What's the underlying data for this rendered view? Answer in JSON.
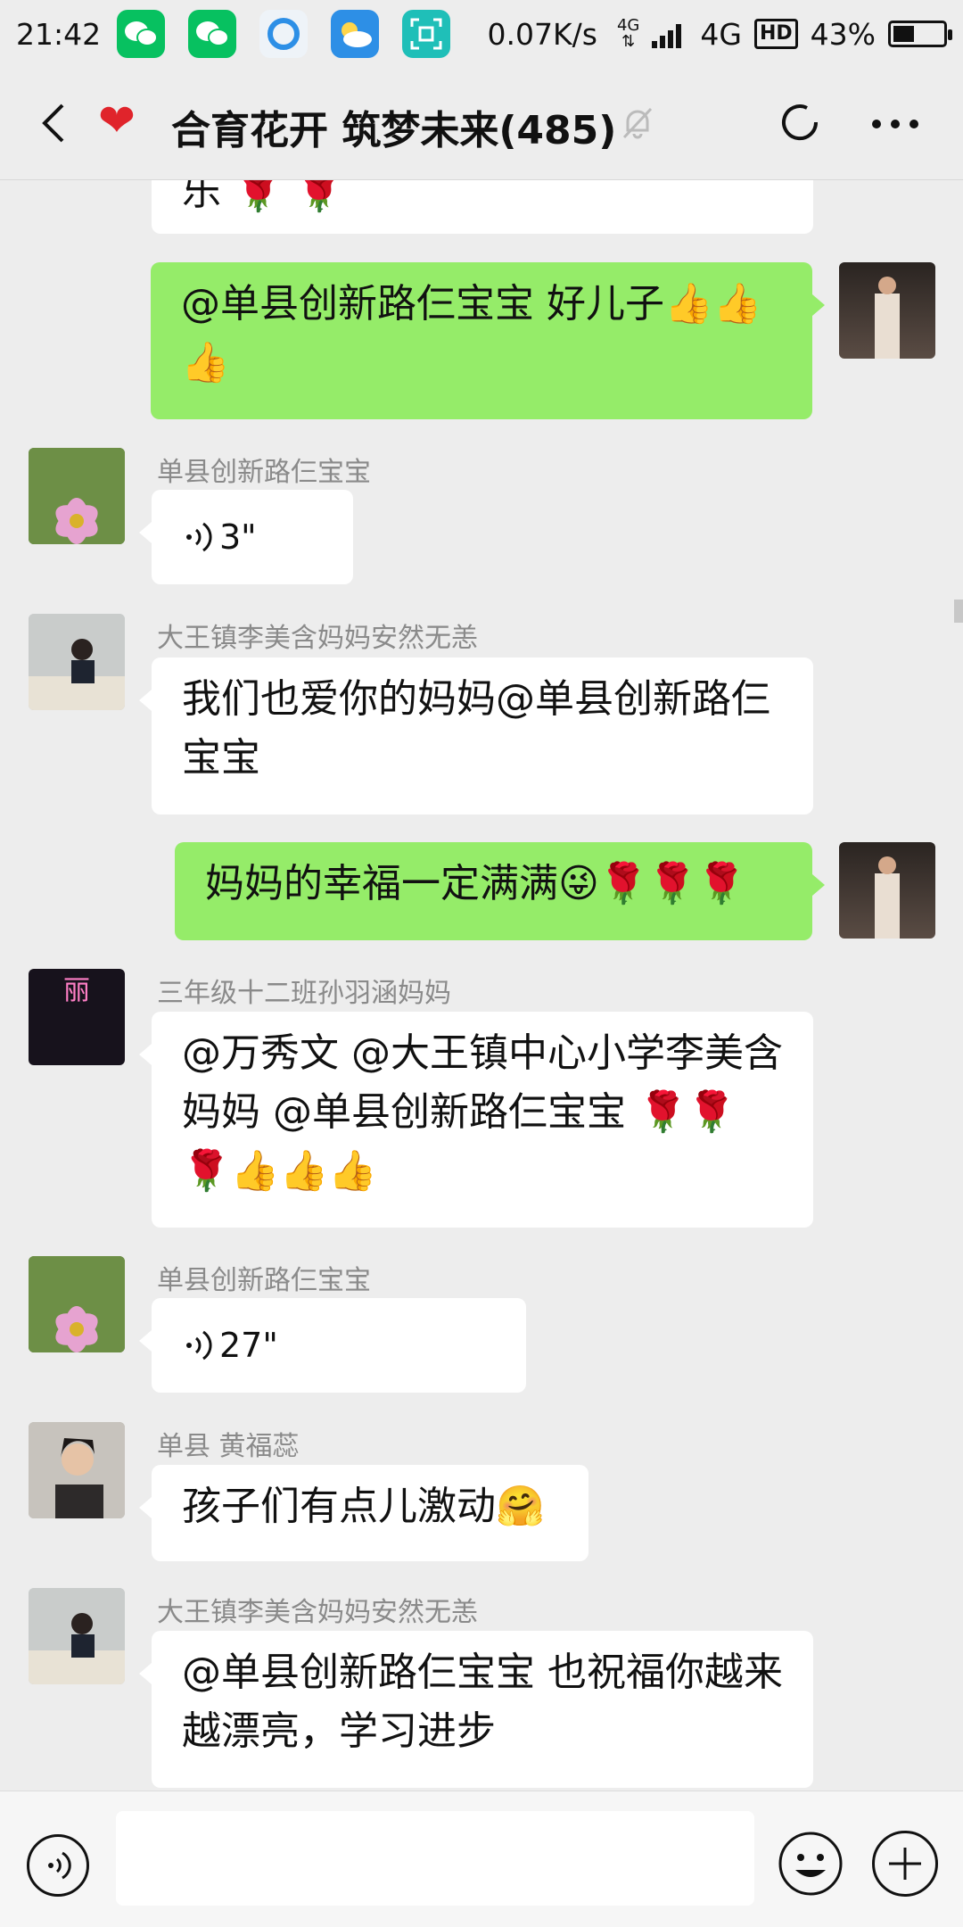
{
  "status_bar": {
    "time": "21:42",
    "net_speed": "0.07K/s",
    "net_type_small": "4G",
    "net_type": "4G",
    "hd": "HD",
    "battery": "43%",
    "battery_level": 0.43,
    "apps": [
      {
        "icon": "wechat-icon",
        "color": "#07c160"
      },
      {
        "icon": "wechat-icon",
        "color": "#07c160"
      },
      {
        "icon": "browser-icon",
        "color": "#eef3f8"
      },
      {
        "icon": "weather-icon",
        "color": "#2d8fe6"
      },
      {
        "icon": "scanner-icon",
        "color": "#1fbfb8"
      }
    ]
  },
  "title_bar": {
    "title": "合育花开 筑梦未来(485)",
    "heart": "❤"
  },
  "messages": {
    "partial_top": "乐 🌹 🌹",
    "m1": "@单县创新路仨宝宝  好儿子👍👍👍",
    "m2_sender": "单县创新路仨宝宝",
    "m2_duration": "3\"",
    "m3_sender": "大王镇李美含妈妈安然无恙",
    "m3": "我们也爱你的妈妈@单县创新路仨宝宝",
    "m4": "妈妈的幸福一定满满😜🌹🌹🌹",
    "m5_sender": "三年级十二班孙羽涵妈妈",
    "m5": "@万秀文 @大王镇中心小学李美含妈妈 @单县创新路仨宝宝 🌹🌹🌹👍👍👍",
    "m5_avatar_text": "丽",
    "m6_sender": "单县创新路仨宝宝",
    "m6_duration": "27\"",
    "m7_sender": "单县  黄福蕊",
    "m7": "孩子们有点儿激动🤗",
    "m8_sender": "大王镇李美含妈妈安然无恙",
    "m8": "@单县创新路仨宝宝  也祝福你越来越漂亮，学习进步"
  },
  "input_bar": {
    "placeholder": ""
  }
}
